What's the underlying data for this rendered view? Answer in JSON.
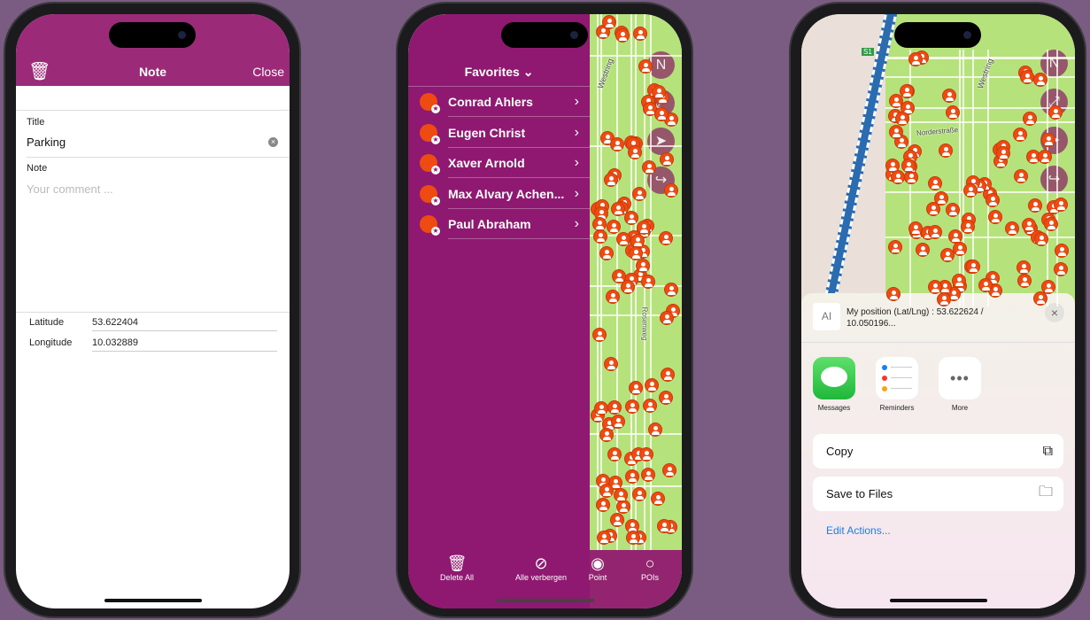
{
  "note_screen": {
    "header": {
      "title": "Note",
      "close_label": "Close",
      "delete_icon": "trash-icon"
    },
    "title_label": "Title",
    "title_value": "Parking",
    "note_label": "Note",
    "note_placeholder": "Your comment ...",
    "latitude_label": "Latitude",
    "latitude_value": "53.622404",
    "longitude_label": "Longitude",
    "longitude_value": "10.032889"
  },
  "favorites_screen": {
    "header": "Favorites",
    "items": [
      {
        "label": "Conrad Ahlers"
      },
      {
        "label": "Eugen Christ"
      },
      {
        "label": "Xaver Arnold"
      },
      {
        "label": "Max Alvary Achen..."
      },
      {
        "label": "Paul Abraham"
      }
    ],
    "map_street_labels": [
      "Westring",
      "Rosenweg"
    ],
    "bottom_bar": [
      {
        "label": "Delete All",
        "icon": "trash-icon"
      },
      {
        "label": "Alle verbergen",
        "icon": "eye-slash-icon"
      },
      {
        "label": "Point",
        "icon": "target-icon"
      },
      {
        "label": "POIs",
        "icon": "circle-icon"
      }
    ]
  },
  "share_screen": {
    "map_labels": [
      "S1",
      "Norderstraße",
      "Westring"
    ],
    "preview_text": "My position (Lat/Lng) : 53.622624 / 10.050196...",
    "apps": [
      {
        "label": "Messages"
      },
      {
        "label": "Reminders"
      },
      {
        "label": "More"
      }
    ],
    "actions": [
      {
        "label": "Copy",
        "icon": "copy-icon"
      },
      {
        "label": "Save to Files",
        "icon": "folder-icon"
      }
    ],
    "edit_actions": "Edit Actions..."
  },
  "colors": {
    "header_purple": "#9b2a78",
    "panel_purple": "#8f1870",
    "marker_orange": "#ee4b12",
    "map_green": "#b6e27c",
    "link_blue": "#1a7ef0"
  }
}
